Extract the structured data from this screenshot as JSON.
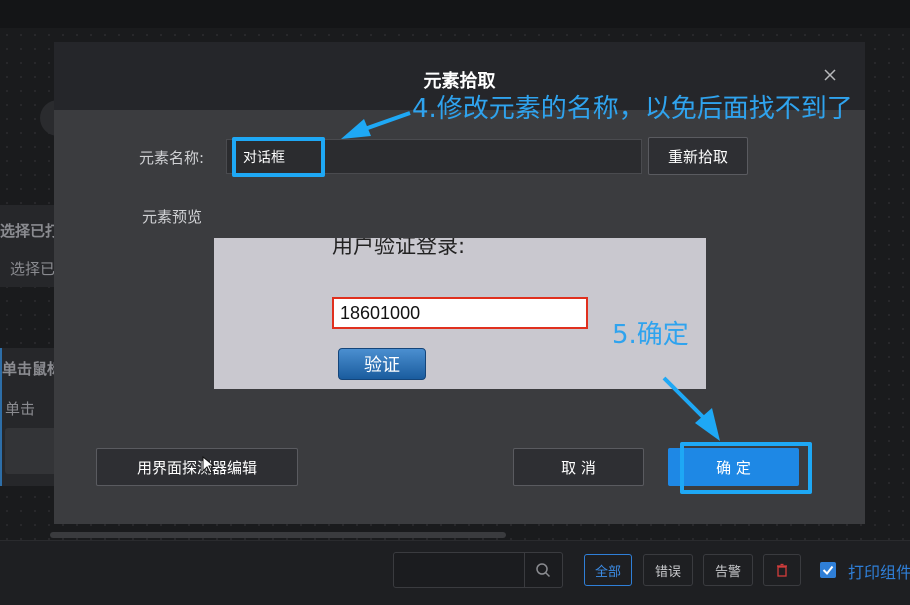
{
  "background": {
    "panel1_title": "选择已打",
    "panel1_text": "选择已",
    "panel2_title": "单击鼠标",
    "panel2_text": "单击"
  },
  "dialog": {
    "title": "元素拾取",
    "name_label": "元素名称:",
    "name_value": "对话框",
    "repick_button": "重新拾取",
    "preview_label": "元素预览",
    "preview": {
      "heading": "用户验证登录:",
      "input_value": "18601000",
      "verify_button": "验证"
    },
    "edit_button": "用界面探测器编辑",
    "cancel_button": "取 消",
    "confirm_button": "确 定"
  },
  "annotations": {
    "step4": "4.修改元素的名称，以免后面找不到了",
    "step5": "5.确定",
    "color": "#1ea8f5"
  },
  "bottombar": {
    "search_placeholder": "",
    "filters": [
      "全部",
      "错误",
      "告警"
    ],
    "checkbox_label": "打印组件"
  },
  "colors": {
    "accent": "#1e88e5",
    "annotation": "#2fa3ee",
    "dialog_bg": "#3b3c3f"
  }
}
